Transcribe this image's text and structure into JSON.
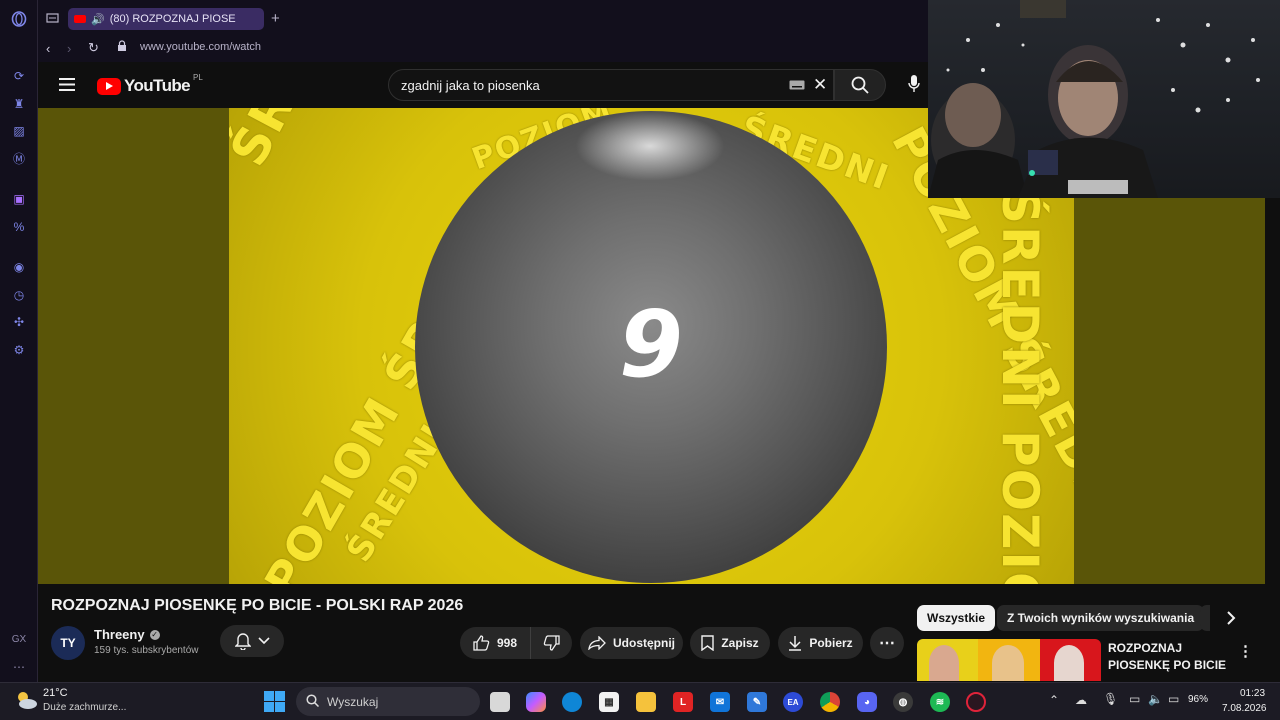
{
  "browser": {
    "tab_title": "(80) ROZPOZNAJ PIOSE",
    "url": "www.youtube.com/watch"
  },
  "youtube": {
    "logo_text": "YouTube",
    "region": "PL",
    "search_query": "zgadnij jaka to piosenka"
  },
  "player": {
    "countdown": "9",
    "ring_words": [
      "ŚREDNI POZIOM",
      "POZIOM ŚREDNI",
      "ŚREDNI POZIOM",
      "POZIOM",
      "ŚREDNI",
      "POZIOM ŚREDNI",
      "ŚREDNI POZIOM"
    ]
  },
  "video": {
    "title": "ROZPOZNAJ PIOSENKĘ PO BICIE - POLSKI RAP 2026",
    "channel_name": "Threeny",
    "channel_avatar": "TY",
    "subscribers": "159 tys. subskrybentów",
    "likes": "998",
    "share_label": "Udostępnij",
    "save_label": "Zapisz",
    "download_label": "Pobierz"
  },
  "recommendations": {
    "chips": [
      "Wszystkie",
      "Z Twoich wyników wyszukiwania"
    ],
    "first_title": "ROZPOZNAJ PIOSENKĘ PO BICIE -..."
  },
  "sidebar_icons": [
    "history-icon",
    "gamepad-icon",
    "layers-icon",
    "messenger-icon",
    "twitch-icon",
    "percent-icon",
    "play-circle-icon",
    "clock-icon",
    "puzzle-icon",
    "settings-icon"
  ],
  "taskbar": {
    "weather_temp": "21°C",
    "weather_desc": "Duże zachmurze...",
    "search_placeholder": "Wyszukaj",
    "battery": "96%",
    "time": "01:23",
    "date": "7.08.2026"
  },
  "colors": {
    "yt_red": "#ff0000",
    "opera_accent": "#7e86e8",
    "video_yellow": "#e9d40c"
  }
}
